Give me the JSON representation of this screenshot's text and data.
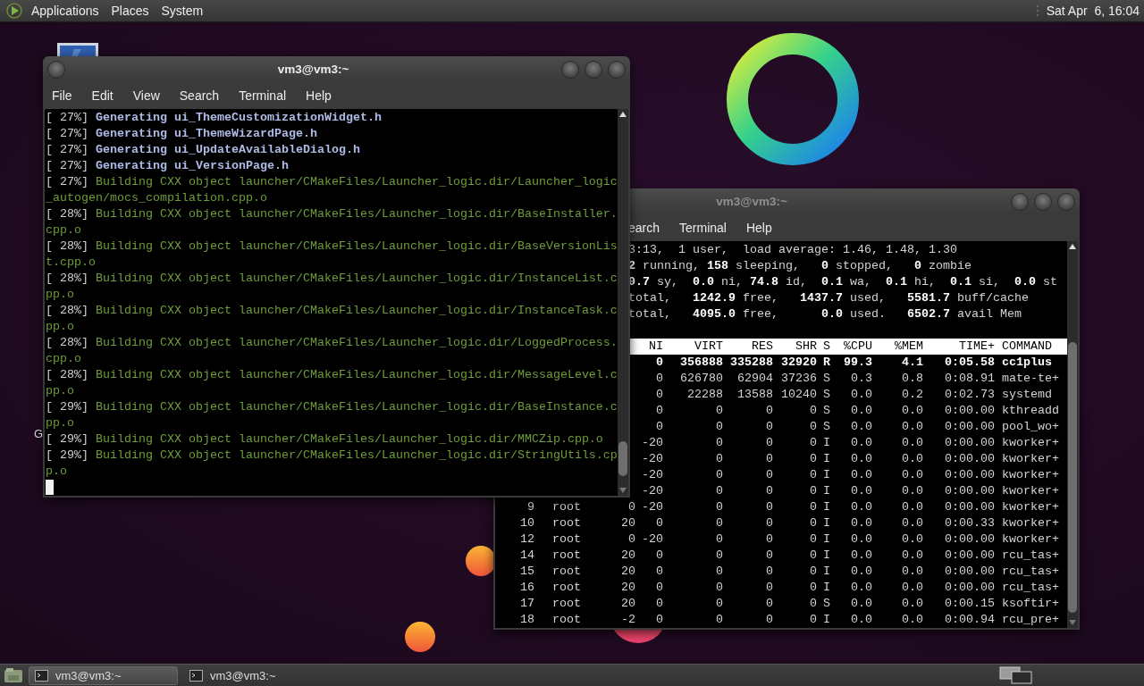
{
  "top_panel": {
    "menus": [
      "Applications",
      "Places",
      "System"
    ],
    "clock": "Sat Apr  6, 16:04"
  },
  "desktop": {
    "icon_label": "G"
  },
  "build_terminal": {
    "title": "vm3@vm3:~",
    "active": true,
    "menu": [
      "File",
      "Edit",
      "View",
      "Search",
      "Terminal",
      "Help"
    ],
    "lines": [
      {
        "kind": "generating",
        "progress": "[ 27%]",
        "text": "Generating ui_ThemeCustomizationWidget.h"
      },
      {
        "kind": "generating",
        "progress": "[ 27%]",
        "text": "Generating ui_ThemeWizardPage.h"
      },
      {
        "kind": "generating",
        "progress": "[ 27%]",
        "text": "Generating ui_UpdateAvailableDialog.h"
      },
      {
        "kind": "generating",
        "progress": "[ 27%]",
        "text": "Generating ui_VersionPage.h"
      },
      {
        "kind": "building",
        "progress": "[ 27%]",
        "text": "Building CXX object launcher/CMakeFiles/Launcher_logic.dir/Launcher_logic_autogen/mocs_compilation.cpp.o"
      },
      {
        "kind": "building",
        "progress": "[ 28%]",
        "text": "Building CXX object launcher/CMakeFiles/Launcher_logic.dir/BaseInstaller.cpp.o"
      },
      {
        "kind": "building",
        "progress": "[ 28%]",
        "text": "Building CXX object launcher/CMakeFiles/Launcher_logic.dir/BaseVersionList.cpp.o"
      },
      {
        "kind": "building",
        "progress": "[ 28%]",
        "text": "Building CXX object launcher/CMakeFiles/Launcher_logic.dir/InstanceList.cpp.o"
      },
      {
        "kind": "building",
        "progress": "[ 28%]",
        "text": "Building CXX object launcher/CMakeFiles/Launcher_logic.dir/InstanceTask.cpp.o"
      },
      {
        "kind": "building",
        "progress": "[ 28%]",
        "text": "Building CXX object launcher/CMakeFiles/Launcher_logic.dir/LoggedProcess.cpp.o"
      },
      {
        "kind": "building",
        "progress": "[ 28%]",
        "text": "Building CXX object launcher/CMakeFiles/Launcher_logic.dir/MessageLevel.cpp.o"
      },
      {
        "kind": "building",
        "progress": "[ 29%]",
        "text": "Building CXX object launcher/CMakeFiles/Launcher_logic.dir/BaseInstance.cpp.o"
      },
      {
        "kind": "building",
        "progress": "[ 29%]",
        "text": "Building CXX object launcher/CMakeFiles/Launcher_logic.dir/MMCZip.cpp.o"
      },
      {
        "kind": "building",
        "progress": "[ 29%]",
        "text": "Building CXX object launcher/CMakeFiles/Launcher_logic.dir/StringUtils.cpp.o"
      }
    ]
  },
  "top_terminal": {
    "title": "vm3@vm3:~",
    "active": false,
    "menu": [
      "earch",
      "Terminal",
      "Help"
    ],
    "summary": [
      "3:13,  1 user,  load average: 1.46, 1.48, 1.30",
      "**2** running, **158** sleeping,   **0** stopped,   **0** zombie",
      "**0.7** sy,  **0.0** ni, **74.8** id,  **0.1** wa,  **0.1** hi,  **0.1** si,  **0.0** st",
      "total,   **1242.9** free,   **1437.7** used,   **5581.7** buff/cache",
      "total,   **4095.0** free,      **0.0** used.   **6502.7** avail Mem"
    ],
    "columns": {
      "ni": "NI",
      "virt": "VIRT",
      "res": "RES",
      "shr": "SHR",
      "s": "S",
      "cpu": "%CPU",
      "mem": "%MEM",
      "time": "TIME+",
      "command": "COMMAND"
    },
    "processes": [
      {
        "highlighted": true,
        "ni": "0",
        "virt": "356888",
        "res": "335288",
        "shr": "32920",
        "s": "R",
        "cpu": "99.3",
        "mem": "4.1",
        "time": "0:05.58",
        "command": "cc1plus"
      },
      {
        "highlighted": false,
        "ni": "0",
        "virt": "626780",
        "res": "62904",
        "shr": "37236",
        "s": "S",
        "cpu": "0.3",
        "mem": "0.8",
        "time": "0:08.91",
        "command": "mate-te+"
      },
      {
        "highlighted": false,
        "ni": "0",
        "virt": "22288",
        "res": "13588",
        "shr": "10240",
        "s": "S",
        "cpu": "0.0",
        "mem": "0.2",
        "time": "0:02.73",
        "command": "systemd"
      },
      {
        "highlighted": false,
        "ni": "0",
        "virt": "0",
        "res": "0",
        "shr": "0",
        "s": "S",
        "cpu": "0.0",
        "mem": "0.0",
        "time": "0:00.00",
        "command": "kthreadd"
      },
      {
        "highlighted": false,
        "ni": "0",
        "virt": "0",
        "res": "0",
        "shr": "0",
        "s": "S",
        "cpu": "0.0",
        "mem": "0.0",
        "time": "0:00.00",
        "command": "pool_wo+"
      },
      {
        "highlighted": false,
        "ni": "-20",
        "virt": "0",
        "res": "0",
        "shr": "0",
        "s": "I",
        "cpu": "0.0",
        "mem": "0.0",
        "time": "0:00.00",
        "command": "kworker+"
      },
      {
        "highlighted": false,
        "ni": "-20",
        "virt": "0",
        "res": "0",
        "shr": "0",
        "s": "I",
        "cpu": "0.0",
        "mem": "0.0",
        "time": "0:00.00",
        "command": "kworker+"
      },
      {
        "highlighted": false,
        "ni": "-20",
        "virt": "0",
        "res": "0",
        "shr": "0",
        "s": "I",
        "cpu": "0.0",
        "mem": "0.0",
        "time": "0:00.00",
        "command": "kworker+"
      },
      {
        "highlighted": false,
        "ni": "-20",
        "virt": "0",
        "res": "0",
        "shr": "0",
        "s": "I",
        "cpu": "0.0",
        "mem": "0.0",
        "time": "0:00.00",
        "command": "kworker+"
      },
      {
        "highlighted": false,
        "pid": "9",
        "user": "root",
        "pr": "0",
        "ni": "-20",
        "virt": "0",
        "res": "0",
        "shr": "0",
        "s": "I",
        "cpu": "0.0",
        "mem": "0.0",
        "time": "0:00.00",
        "command": "kworker+"
      },
      {
        "highlighted": false,
        "pid": "10",
        "user": "root",
        "pr": "20",
        "ni": "0",
        "virt": "0",
        "res": "0",
        "shr": "0",
        "s": "I",
        "cpu": "0.0",
        "mem": "0.0",
        "time": "0:00.33",
        "command": "kworker+"
      },
      {
        "highlighted": false,
        "pid": "12",
        "user": "root",
        "pr": "0",
        "ni": "-20",
        "virt": "0",
        "res": "0",
        "shr": "0",
        "s": "I",
        "cpu": "0.0",
        "mem": "0.0",
        "time": "0:00.00",
        "command": "kworker+"
      },
      {
        "highlighted": false,
        "pid": "14",
        "user": "root",
        "pr": "20",
        "ni": "0",
        "virt": "0",
        "res": "0",
        "shr": "0",
        "s": "I",
        "cpu": "0.0",
        "mem": "0.0",
        "time": "0:00.00",
        "command": "rcu_tas+"
      },
      {
        "highlighted": false,
        "pid": "15",
        "user": "root",
        "pr": "20",
        "ni": "0",
        "virt": "0",
        "res": "0",
        "shr": "0",
        "s": "I",
        "cpu": "0.0",
        "mem": "0.0",
        "time": "0:00.00",
        "command": "rcu_tas+"
      },
      {
        "highlighted": false,
        "pid": "16",
        "user": "root",
        "pr": "20",
        "ni": "0",
        "virt": "0",
        "res": "0",
        "shr": "0",
        "s": "I",
        "cpu": "0.0",
        "mem": "0.0",
        "time": "0:00.00",
        "command": "rcu_tas+"
      },
      {
        "highlighted": false,
        "pid": "17",
        "user": "root",
        "pr": "20",
        "ni": "0",
        "virt": "0",
        "res": "0",
        "shr": "0",
        "s": "S",
        "cpu": "0.0",
        "mem": "0.0",
        "time": "0:00.15",
        "command": "ksoftir+"
      },
      {
        "highlighted": false,
        "pid": "18",
        "user": "root",
        "pr": "-2",
        "ni": "0",
        "virt": "0",
        "res": "0",
        "shr": "0",
        "s": "I",
        "cpu": "0.0",
        "mem": "0.0",
        "time": "0:00.94",
        "command": "rcu_pre+"
      }
    ]
  },
  "taskbar": {
    "tasks": [
      {
        "label": "vm3@vm3:~",
        "selected": true
      },
      {
        "label": "vm3@vm3:~",
        "selected": false
      }
    ]
  }
}
